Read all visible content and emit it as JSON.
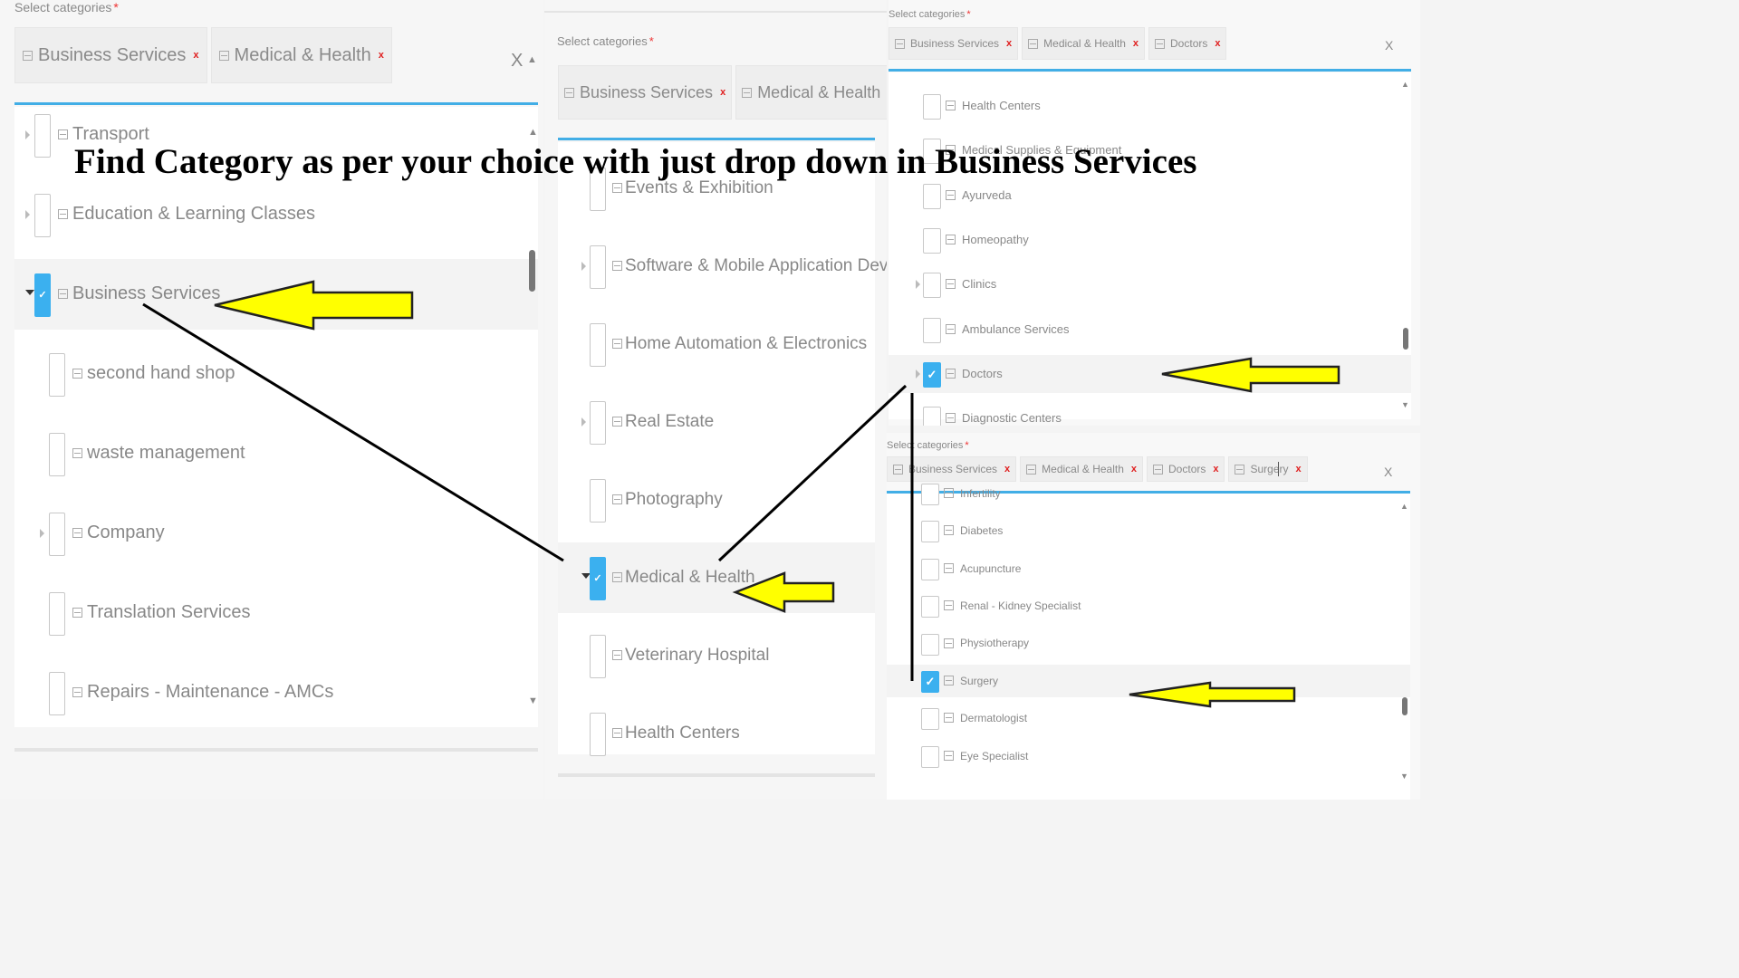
{
  "select_label": "Select categories",
  "required_mark": "*",
  "clear_label": "X",
  "headline": "Find Category as per your choice with just drop down in Business Services",
  "panel_left": {
    "tags": [
      "Business Services",
      "Medical & Health"
    ],
    "items": [
      {
        "label": "Transport",
        "checked": false,
        "caret": true
      },
      {
        "label": "Education & Learning Classes",
        "checked": false,
        "caret": true
      },
      {
        "label": "Business Services",
        "checked": true,
        "caret": true,
        "expanded": true
      },
      {
        "label": "second hand shop",
        "checked": false,
        "caret": false
      },
      {
        "label": "waste management",
        "checked": false,
        "caret": false
      },
      {
        "label": "Company",
        "checked": false,
        "caret": true
      },
      {
        "label": "Translation Services",
        "checked": false,
        "caret": false
      },
      {
        "label": "Repairs - Maintenance - AMCs",
        "checked": false,
        "caret": false
      }
    ]
  },
  "panel_middle": {
    "tags": [
      "Business Services",
      "Medical & Health"
    ],
    "items": [
      {
        "label": "Events & Exhibition",
        "checked": false,
        "caret": false
      },
      {
        "label": "Software & Mobile Application Development",
        "checked": false,
        "caret": true
      },
      {
        "label": "Home Automation & Electronics",
        "checked": false,
        "caret": false
      },
      {
        "label": "Real Estate",
        "checked": false,
        "caret": true
      },
      {
        "label": "Photography",
        "checked": false,
        "caret": false
      },
      {
        "label": "Medical & Health",
        "checked": true,
        "caret": true,
        "expanded": true
      },
      {
        "label": "Veterinary Hospital",
        "checked": false,
        "caret": false
      },
      {
        "label": "Health Centers",
        "checked": false,
        "caret": false
      }
    ]
  },
  "panel_top_right": {
    "tags": [
      "Business Services",
      "Medical & Health",
      "Doctors"
    ],
    "items": [
      {
        "label": "Health Centers",
        "checked": false,
        "caret": false
      },
      {
        "label": "Medical Supplies & Equipment",
        "checked": false,
        "caret": false
      },
      {
        "label": "Ayurveda",
        "checked": false,
        "caret": false
      },
      {
        "label": "Homeopathy",
        "checked": false,
        "caret": false
      },
      {
        "label": "Clinics",
        "checked": false,
        "caret": true
      },
      {
        "label": "Ambulance Services",
        "checked": false,
        "caret": false
      },
      {
        "label": "Doctors",
        "checked": true,
        "caret": true
      },
      {
        "label": "Diagnostic Centers",
        "checked": false,
        "caret": false
      }
    ]
  },
  "panel_bottom_right": {
    "tags": [
      "Business Services",
      "Medical & Health",
      "Doctors",
      "Surgery"
    ],
    "items": [
      {
        "label": "Infertility",
        "checked": false,
        "caret": false
      },
      {
        "label": "Diabetes",
        "checked": false,
        "caret": false
      },
      {
        "label": "Acupuncture",
        "checked": false,
        "caret": false
      },
      {
        "label": "Renal - Kidney Specialist",
        "checked": false,
        "caret": false
      },
      {
        "label": "Physiotherapy",
        "checked": false,
        "caret": false
      },
      {
        "label": "Surgery",
        "checked": true,
        "caret": false
      },
      {
        "label": "Dermatologist",
        "checked": false,
        "caret": false
      },
      {
        "label": "Eye Specialist",
        "checked": false,
        "caret": false
      }
    ]
  }
}
